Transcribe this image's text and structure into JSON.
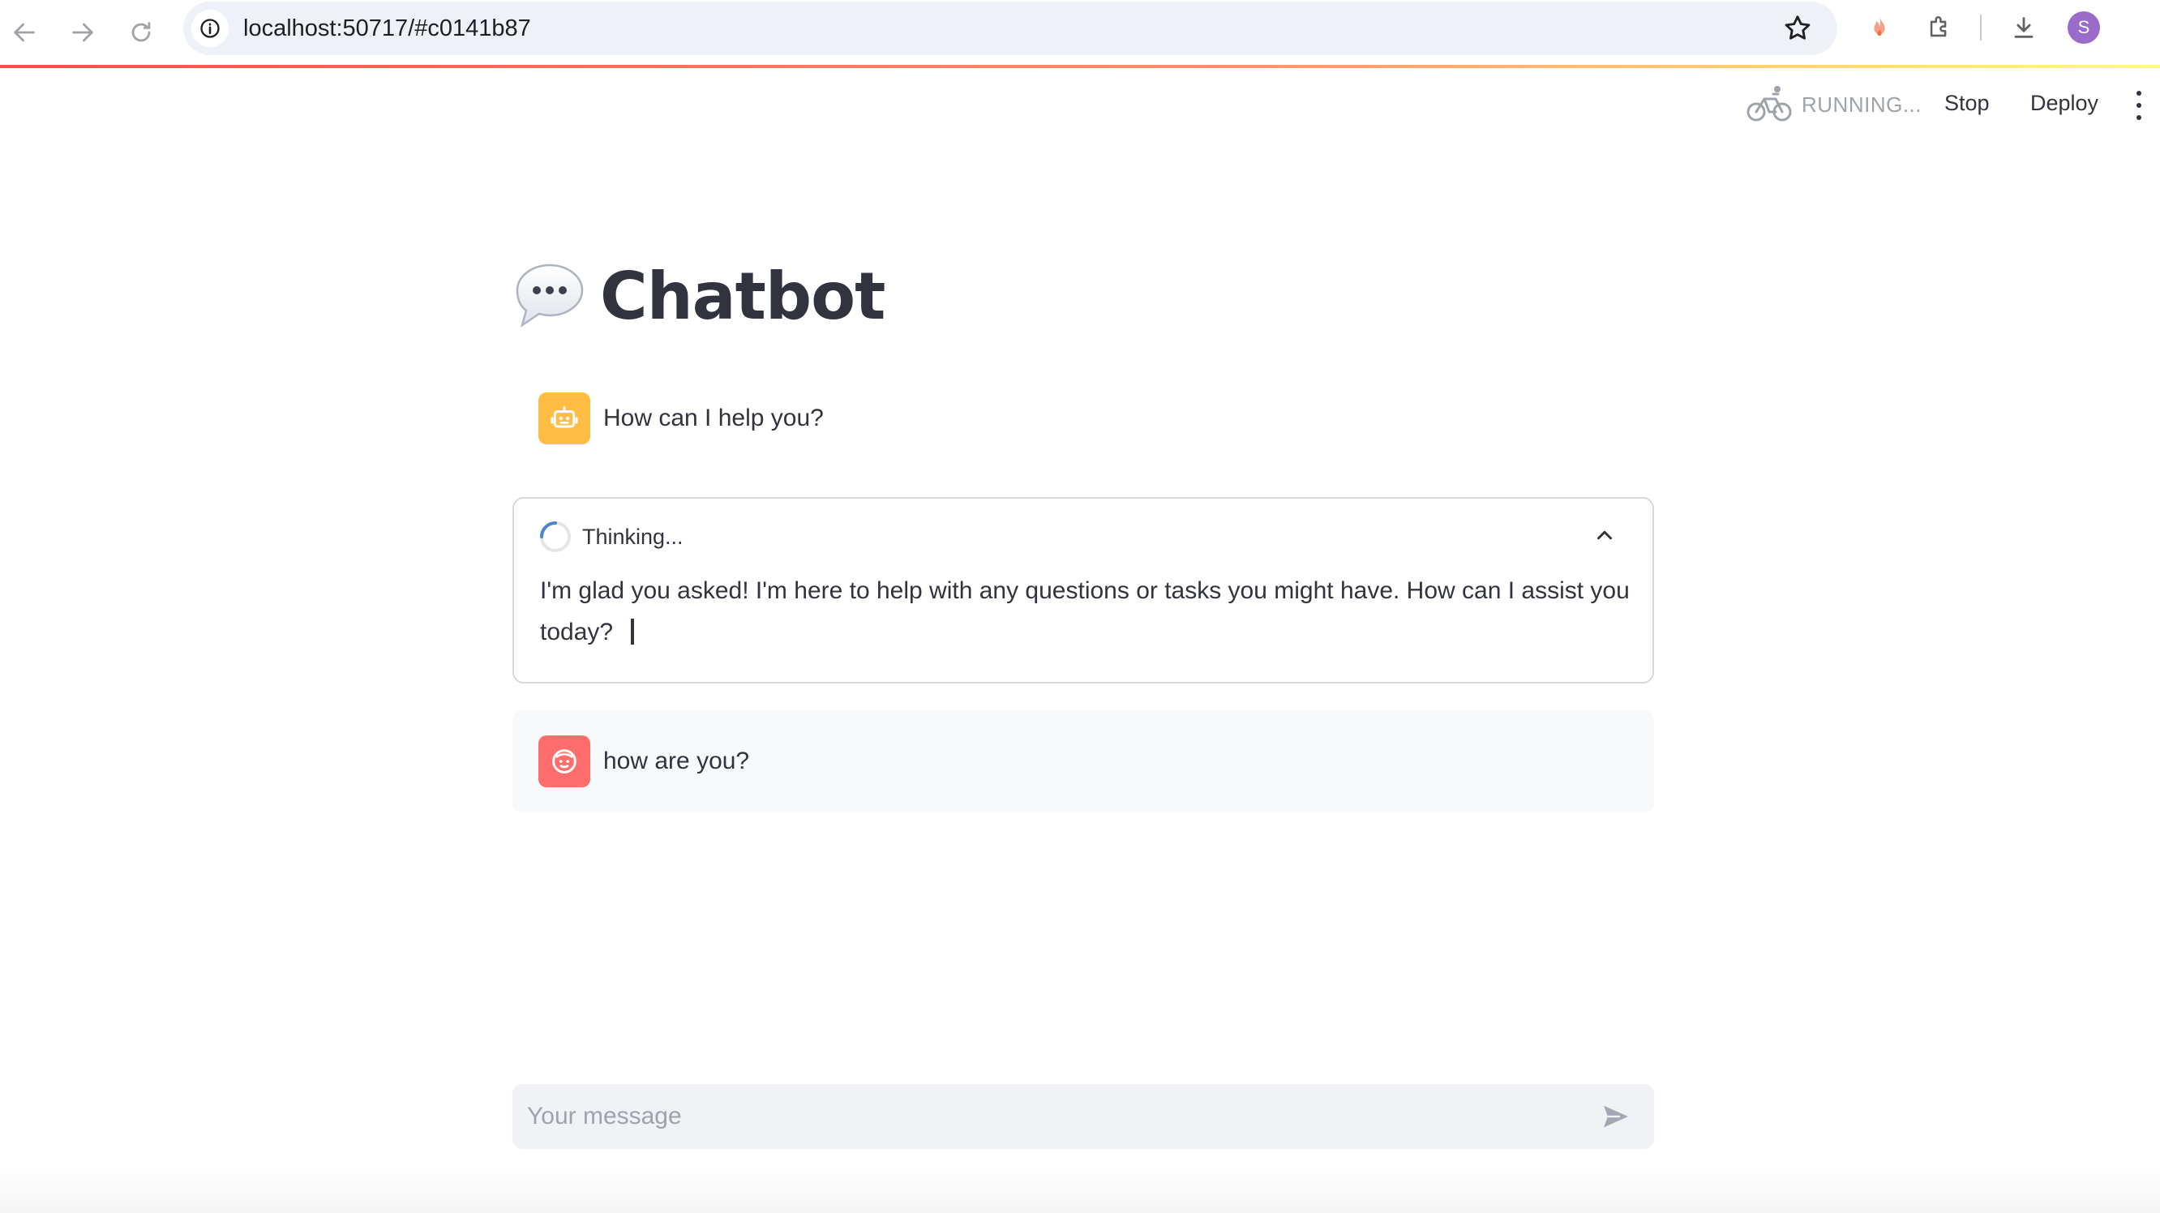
{
  "browser": {
    "url": "localhost:50717/#c0141b87",
    "profile_initial": "S",
    "icons": {
      "back": "arrow-left-icon",
      "forward": "arrow-right-icon",
      "reload": "reload-icon",
      "site_info": "info-icon",
      "bookmark": "star-icon",
      "extension_1": "flame-extension-icon",
      "extensions": "puzzle-icon",
      "downloads": "download-icon"
    }
  },
  "toolbar": {
    "status": "RUNNING...",
    "stop_label": "Stop",
    "deploy_label": "Deploy",
    "running_icon": "bicycle-icon",
    "menu_icon": "vertical-dots-icon"
  },
  "page": {
    "title_emoji": "speech-bubble-icon",
    "title": "Chatbot"
  },
  "messages": [
    {
      "role": "assistant",
      "avatar": "robot-icon",
      "avatar_color": "#ffbd45",
      "text": "How can I help you?"
    },
    {
      "role": "status",
      "label": "Thinking...",
      "expanded": true,
      "text": "I'm glad you asked! I'm here to help with any questions or tasks you might have. How can I assist you today?"
    },
    {
      "role": "user",
      "avatar": "smiley-face-icon",
      "avatar_color": "#ff6c6c",
      "text": "how are you?"
    }
  ],
  "chat_input": {
    "placeholder": "Your message",
    "value": "",
    "send_icon": "send-icon"
  },
  "colors": {
    "accent": "#ff4b4b",
    "text": "#31333f",
    "muted": "#9ea2ab",
    "user_bg": "#f8f9fb",
    "input_bg": "#f0f2f6"
  }
}
